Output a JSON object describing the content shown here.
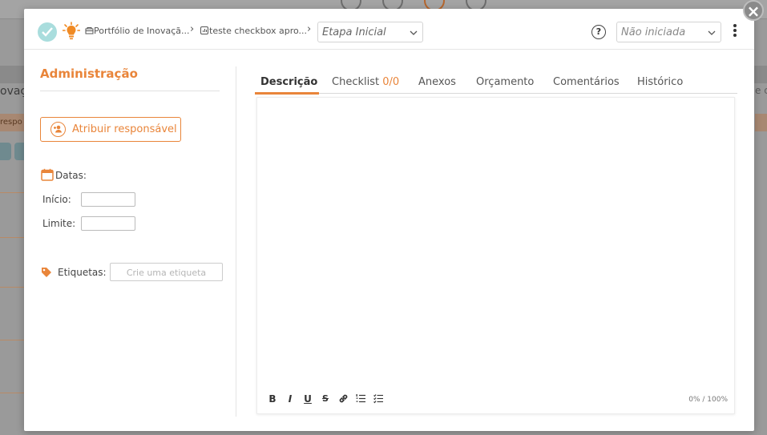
{
  "header": {
    "breadcrumb": [
      {
        "label": "Portfólio de Inovaçã..."
      },
      {
        "label": "teste checkbox apro..."
      }
    ],
    "stage": {
      "value": "Etapa Inicial"
    },
    "help": {
      "label": "?"
    },
    "status": {
      "value": "Não iniciada"
    }
  },
  "left": {
    "section_title": "Administração",
    "assign_button": "Atribuir responsável",
    "dates_label": "Datas:",
    "start_label": "Início:",
    "limit_label": "Limite:",
    "tags_label": "Etiquetas:",
    "tags_placeholder": "Crie uma etiqueta"
  },
  "tabs": [
    {
      "label": "Descrição"
    },
    {
      "label": "Checklist ",
      "count": "0/0"
    },
    {
      "label": "Anexos"
    },
    {
      "label": "Orçamento"
    },
    {
      "label": "Comentários"
    },
    {
      "label": "Histórico"
    }
  ],
  "editor": {
    "toolbar": {
      "bold": "B",
      "italic": "I",
      "underline": "U",
      "strike": "S"
    },
    "counter": "0% / 100%"
  },
  "background": {
    "left_text": "ovaçã",
    "left_chip": "respo",
    "right_text": "e co"
  },
  "colors": {
    "accent": "#e9853a",
    "check_bg": "#a9dddd"
  }
}
